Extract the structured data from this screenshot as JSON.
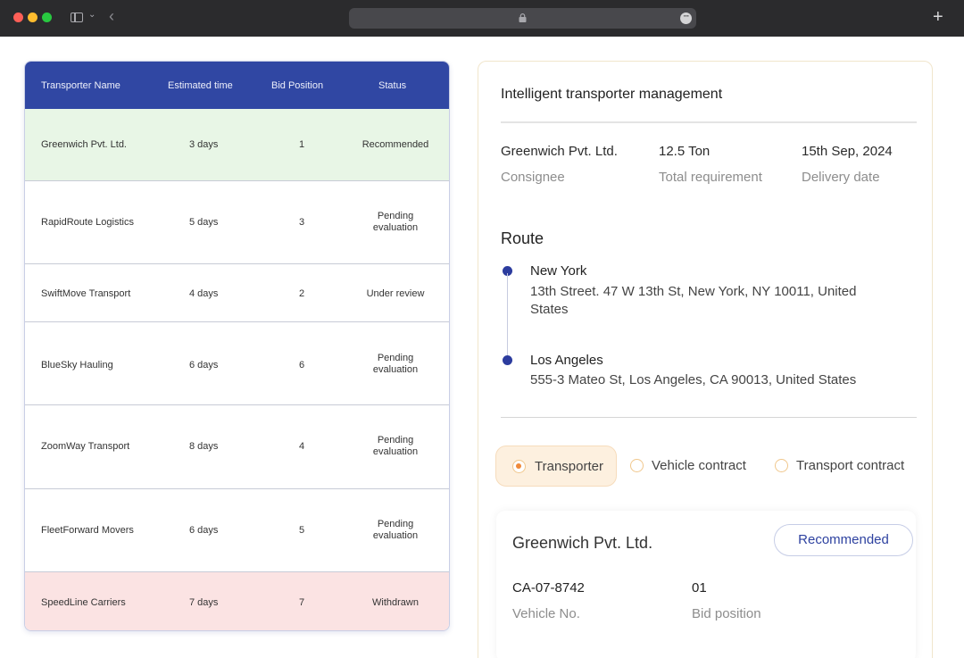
{
  "table": {
    "headers": [
      "Transporter Name",
      "Estimated time",
      "Bid Position",
      "Status"
    ],
    "rows": [
      {
        "name": "Greenwich Pvt. Ltd.",
        "time": "3 days",
        "bid": "1",
        "status": "Recommended"
      },
      {
        "name": "RapidRoute Logistics",
        "time": "5 days",
        "bid": "3",
        "status": "Pending evaluation"
      },
      {
        "name": "SwiftMove Transport",
        "time": "4 days",
        "bid": "2",
        "status": "Under review"
      },
      {
        "name": "BlueSky Hauling",
        "time": "6 days",
        "bid": "6",
        "status": "Pending evaluation"
      },
      {
        "name": "ZoomWay Transport",
        "time": "8 days",
        "bid": "4",
        "status": "Pending evaluation"
      },
      {
        "name": "FleetForward Movers",
        "time": "6 days",
        "bid": "5",
        "status": "Pending evaluation"
      },
      {
        "name": "SpeedLine Carriers",
        "time": "7 days",
        "bid": "7",
        "status": "Withdrawn"
      }
    ]
  },
  "panel": {
    "title": "Intelligent transporter management",
    "consignee_value": "Greenwich Pvt. Ltd.",
    "consignee_label": "Consignee",
    "requirement_value": "12.5 Ton",
    "requirement_label": "Total requirement",
    "delivery_value": "15th Sep, 2024",
    "delivery_label": "Delivery date",
    "route_title": "Route",
    "origin_city": "New York",
    "origin_address": "13th Street. 47 W 13th St, New York, NY 10011, United States",
    "dest_city": "Los Angeles",
    "dest_address": "555-3 Mateo St, Los Angeles, CA 90013, United States",
    "tabs": [
      "Transporter",
      "Vehicle contract",
      "Transport contract"
    ],
    "selected_tab": "Transporter"
  },
  "detail": {
    "name": "Greenwich Pvt. Ltd.",
    "badge": "Recommended",
    "vehicle_value": "CA-07-8742",
    "vehicle_label": "Vehicle No.",
    "bid_value": "01",
    "bid_label": "Bid position"
  },
  "colors": {
    "header": "#3047a3",
    "recommended_row": "#e8f6e6",
    "withdrawn_row": "#fbe3e3",
    "accent": "#ef8a3a"
  }
}
